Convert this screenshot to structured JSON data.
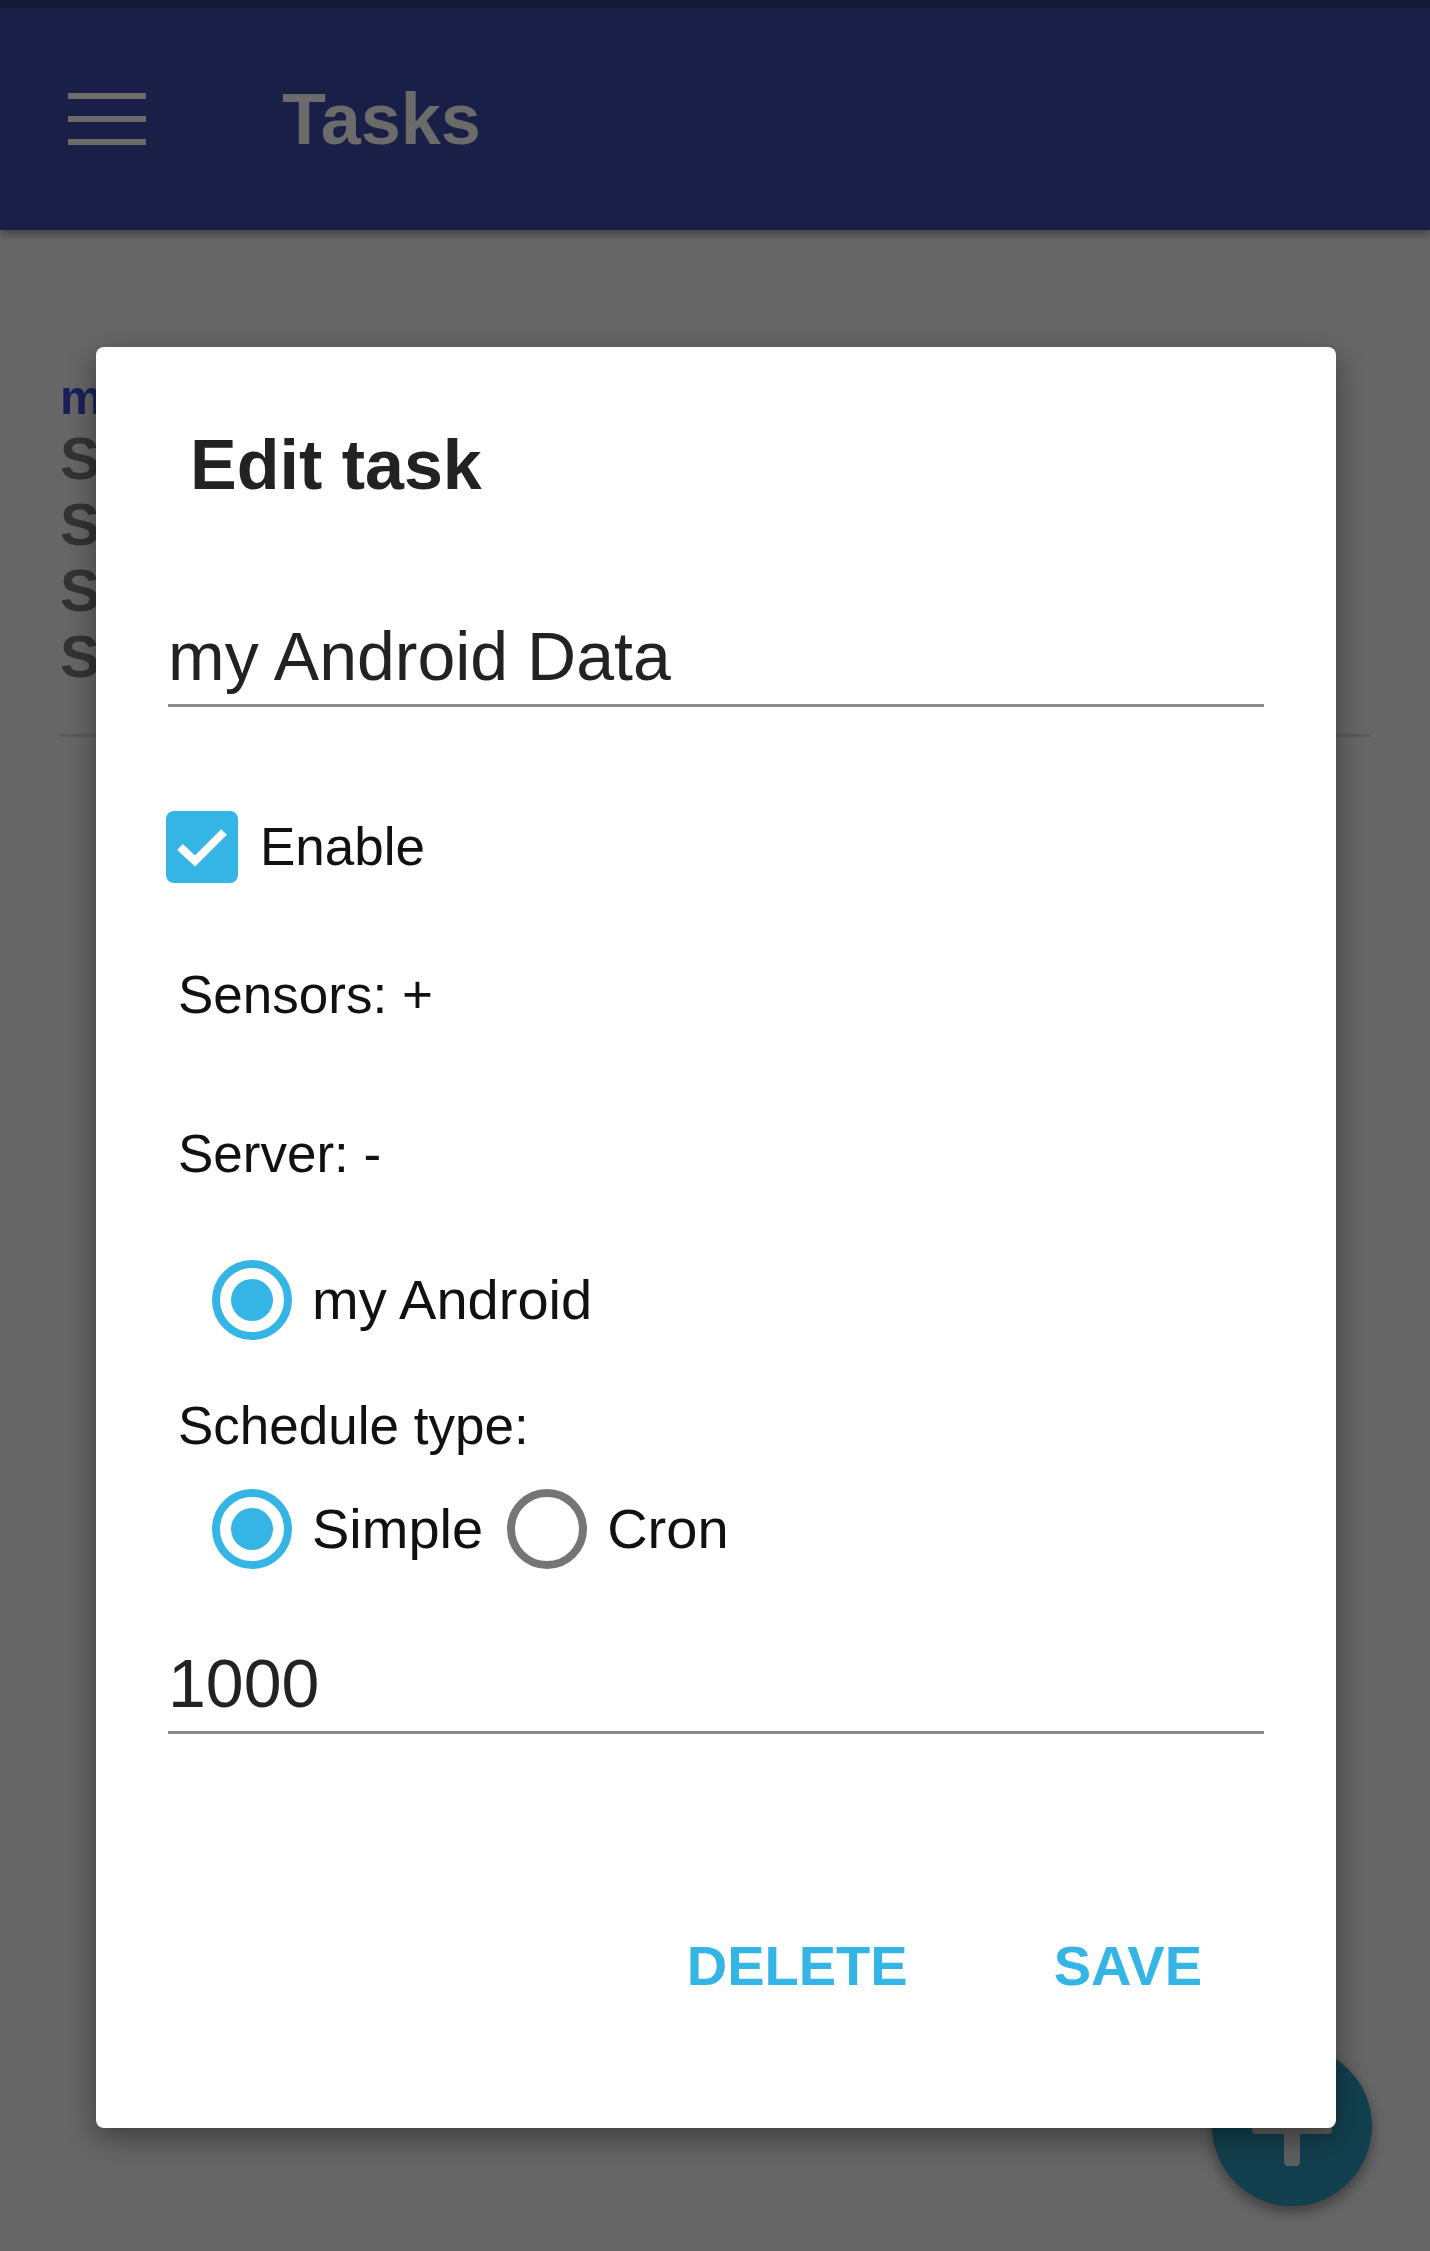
{
  "app_bar": {
    "title": "Tasks"
  },
  "background_list": {
    "title": "m",
    "lines": [
      "S",
      "S",
      "S",
      "S"
    ]
  },
  "dialog": {
    "title": "Edit task",
    "name_field": {
      "value": "my Android Data"
    },
    "enable": {
      "label": "Enable",
      "checked": true
    },
    "sensors_label": "Sensors: +",
    "server_label": "Server: -",
    "servers": [
      {
        "label": "my Android",
        "selected": true
      }
    ],
    "schedule_label": "Schedule type:",
    "schedule_types": [
      {
        "label": "Simple",
        "selected": true
      },
      {
        "label": "Cron",
        "selected": false
      }
    ],
    "interval_field": {
      "value": "1000"
    },
    "buttons": [
      "DELETE",
      "SAVE"
    ]
  }
}
